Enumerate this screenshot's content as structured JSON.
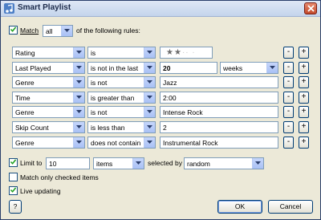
{
  "window": {
    "title": "Smart Playlist"
  },
  "match": {
    "checkbox_label": "Match",
    "mode": "all",
    "suffix": "of the following rules:"
  },
  "rules": [
    {
      "field": "Rating",
      "operator": "is",
      "rating_stars": 2,
      "rating_max": 5
    },
    {
      "field": "Last Played",
      "operator": "is not in the last",
      "value": "20",
      "unit": "weeks"
    },
    {
      "field": "Genre",
      "operator": "is not",
      "value": "Jazz"
    },
    {
      "field": "Time",
      "operator": "is greater than",
      "value": "2:00"
    },
    {
      "field": "Genre",
      "operator": "is not",
      "value": "Intense Rock"
    },
    {
      "field": "Skip Count",
      "operator": "is less than",
      "value": "2"
    },
    {
      "field": "Genre",
      "operator": "does not contain",
      "value": "Instrumental Rock"
    }
  ],
  "rule_buttons": {
    "remove": "-",
    "add": "+"
  },
  "limit": {
    "label": "Limit to",
    "value": "10",
    "unit": "items",
    "selected_by_label": "selected by",
    "selected_by": "random"
  },
  "match_checked_label": "Match only checked items",
  "live_updating_label": "Live updating",
  "buttons": {
    "help": "?",
    "ok": "OK",
    "cancel": "Cancel"
  },
  "colors": {
    "title_text": "#1c2a4a",
    "dialog_bg": "#ece9d8",
    "field_border": "#7f9db9",
    "checkbox_tick": "#21a121"
  }
}
